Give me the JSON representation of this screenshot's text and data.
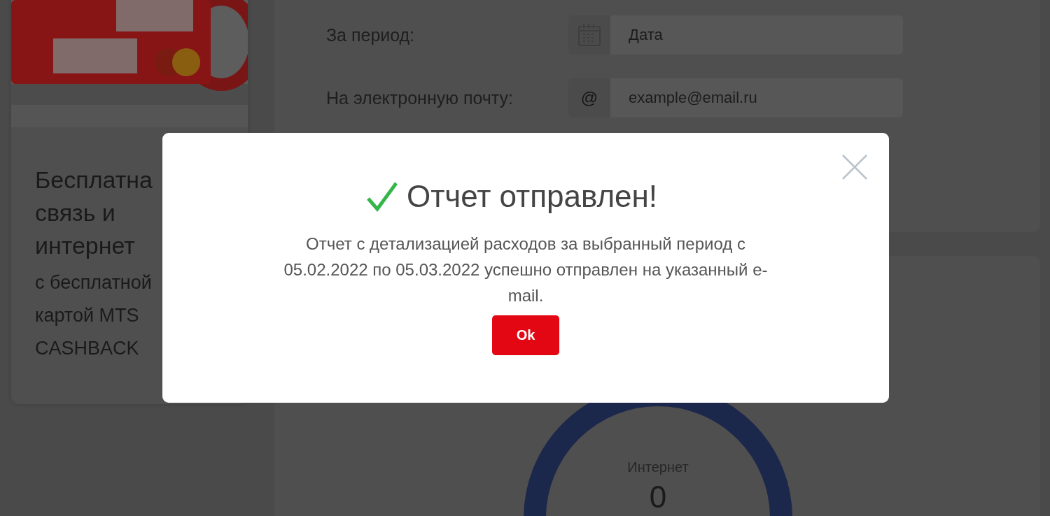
{
  "promo": {
    "title": "Бесплатна связь и интернет",
    "subtitle": "с бесплатной картой MTS CASHBACK"
  },
  "report_form": {
    "fields": [
      {
        "label": "За период:",
        "kind": "date",
        "placeholder": "Дата"
      },
      {
        "label": "На электронную почту:",
        "kind": "email",
        "icon_text": "@",
        "placeholder": "example@email.ru"
      }
    ]
  },
  "usage": {
    "label": "Интернет",
    "value": "0"
  },
  "dialog": {
    "title": "Отчет отправлен!",
    "message": "Отчет с детализацией расходов за выбранный период с 05.02.2022 по 05.03.2022 успешно отправлен на указанный e-mail.",
    "buttons": [
      "Ok"
    ]
  }
}
